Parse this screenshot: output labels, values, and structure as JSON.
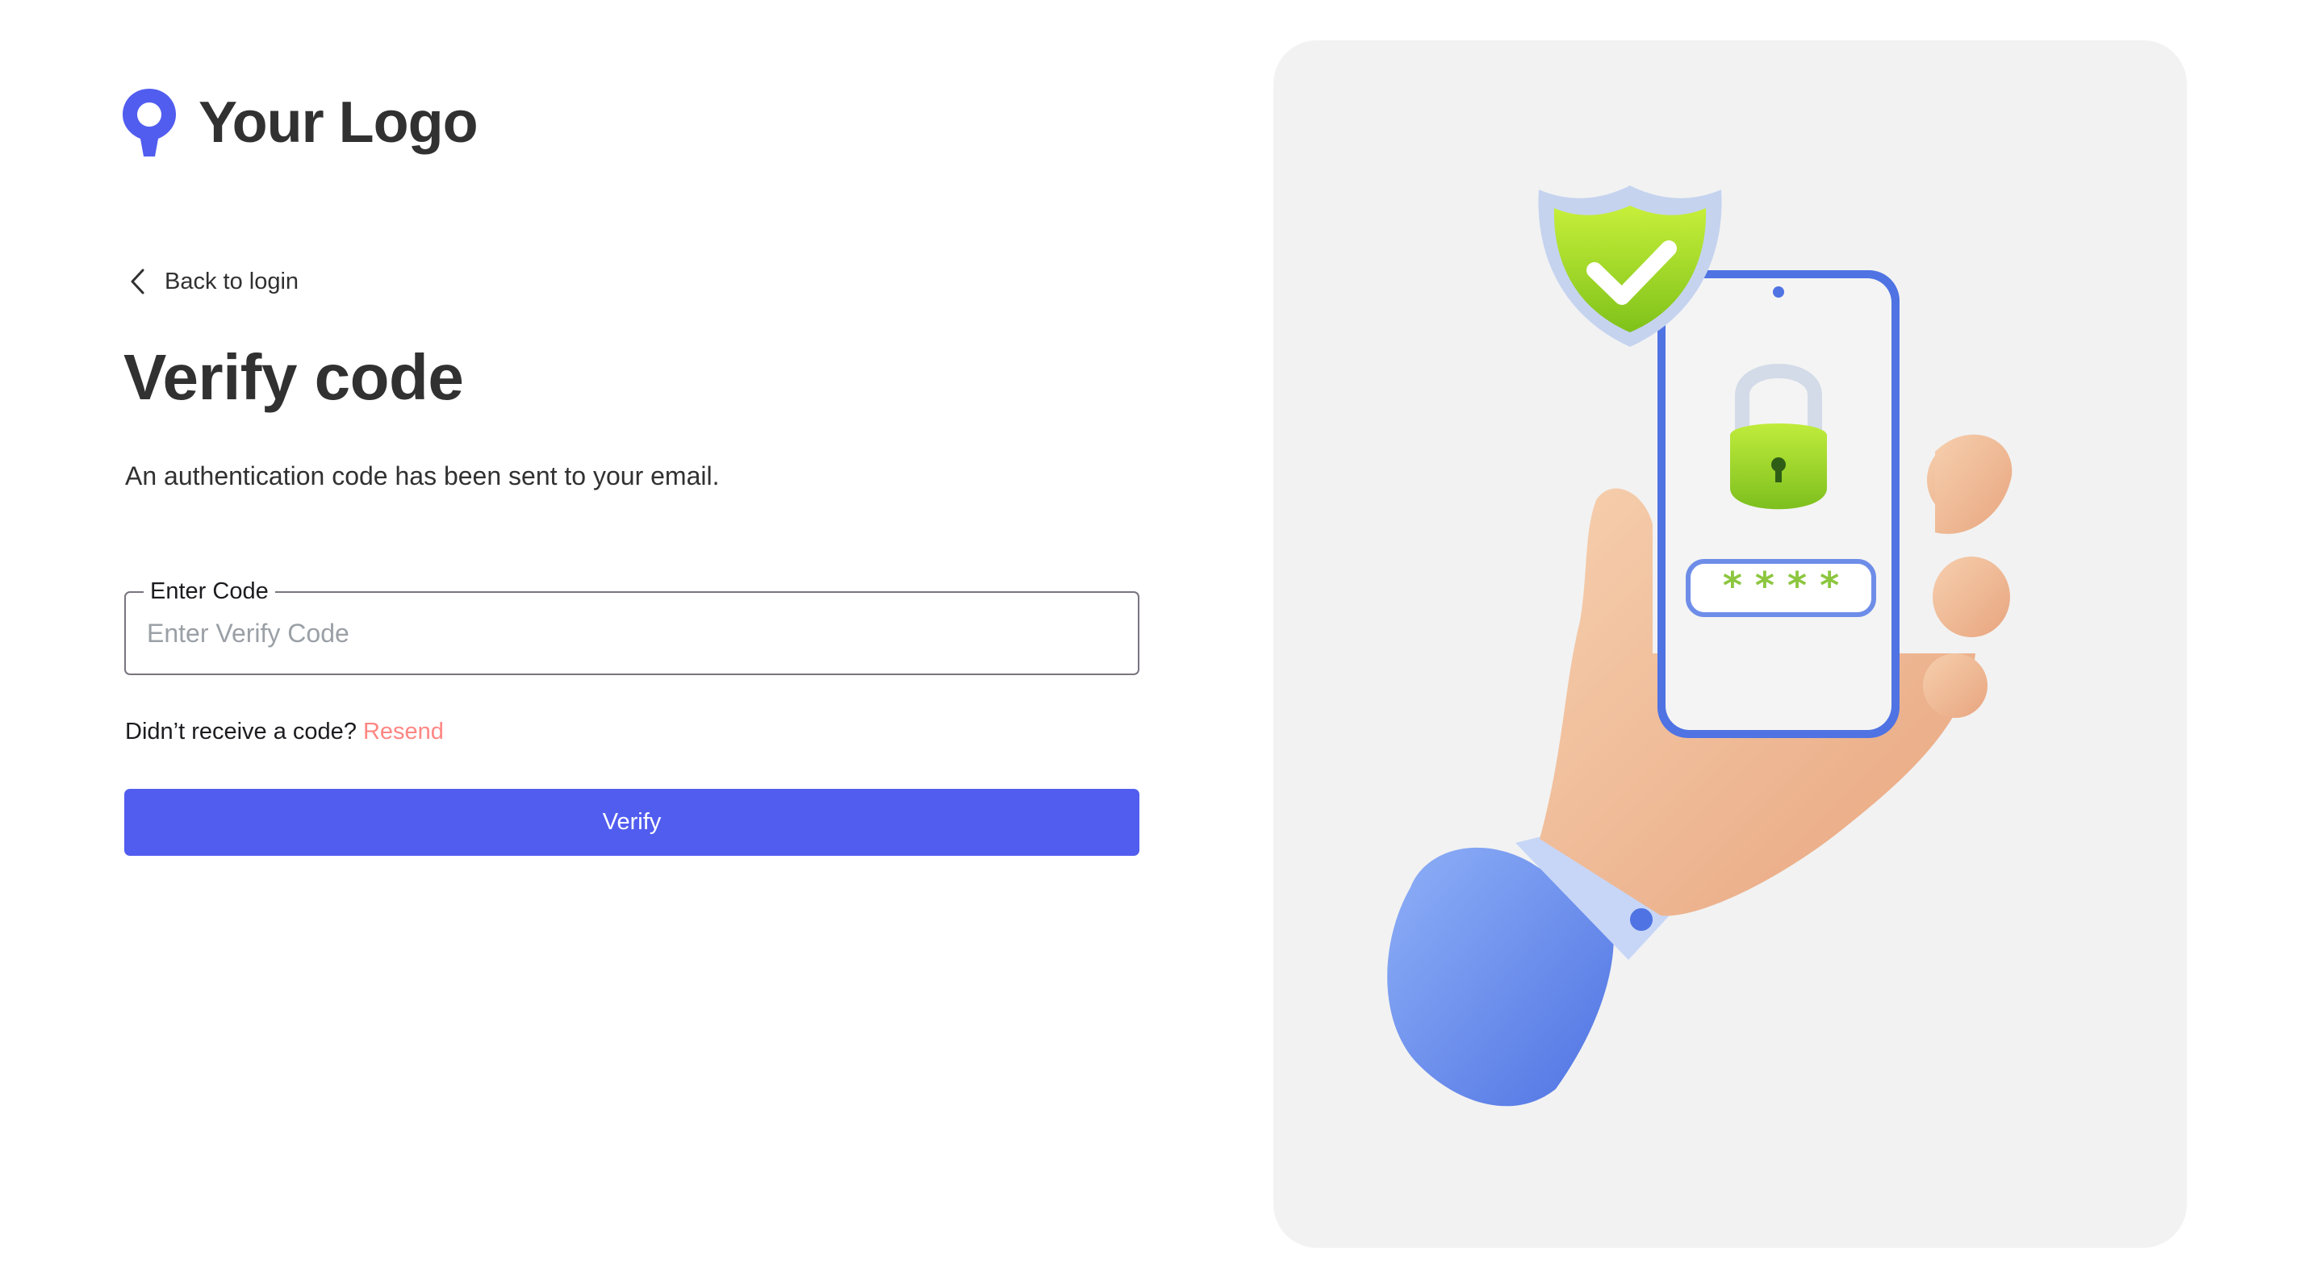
{
  "brand": {
    "logo_text": "Your Logo",
    "accent_color": "#515DEF",
    "logo_icon": "map-pin-logo-icon"
  },
  "nav": {
    "back_label": "Back to login",
    "back_icon": "chevron-left-icon"
  },
  "page": {
    "title": "Verify code",
    "subtitle": "An authentication code has been sent to your email."
  },
  "form": {
    "code_label": "Enter Code",
    "code_value": "",
    "code_placeholder": "Enter Verify Code",
    "resend_prompt": "Didn’t receive a code?",
    "resend_link": "Resend",
    "resend_color": "#FF8682",
    "submit_label": "Verify",
    "submit_color": "#515DEF"
  },
  "illustration": {
    "description_icon": "hand-phone-security-illustration",
    "code_mask": "* * * *"
  }
}
